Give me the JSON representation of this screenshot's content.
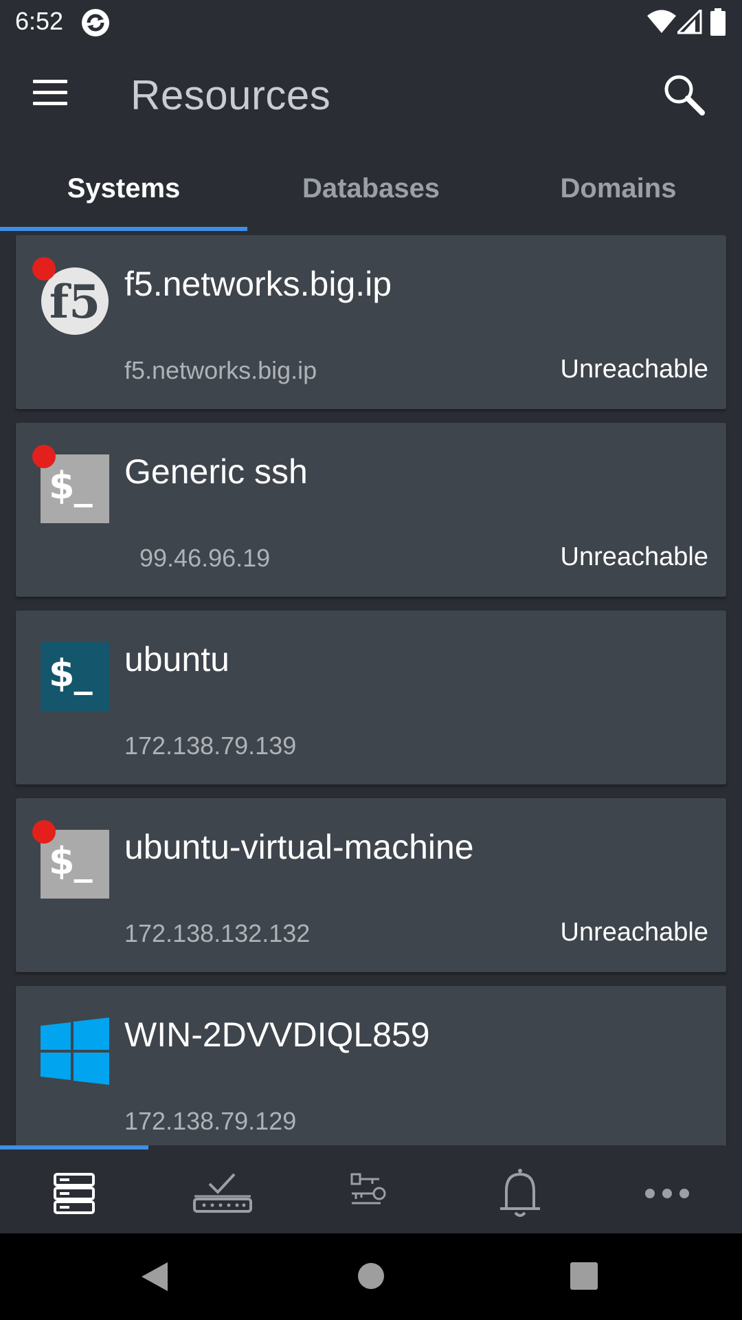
{
  "status_bar": {
    "time": "6:52",
    "app_icon": "sync-badge-icon",
    "icons": [
      "wifi-icon",
      "signal-icon",
      "battery-icon"
    ]
  },
  "app_bar": {
    "title": "Resources",
    "menu_icon": "menu-icon",
    "search_icon": "search-icon"
  },
  "tabs": [
    {
      "label": "Systems",
      "active": true
    },
    {
      "label": "Databases",
      "active": false
    },
    {
      "label": "Domains",
      "active": false
    }
  ],
  "systems": [
    {
      "name": "f5.networks.big.ip",
      "address": "f5.networks.big.ip",
      "status": "Unreachable",
      "icon": "f5-logo-icon",
      "alert": true
    },
    {
      "name": "Generic ssh",
      "address": "99.46.96.19",
      "status": "Unreachable",
      "icon": "ssh-terminal-icon",
      "alert": true
    },
    {
      "name": "ubuntu",
      "address": "172.138.79.139",
      "status": "",
      "icon": "ssh-terminal-icon",
      "alert": false
    },
    {
      "name": "ubuntu-virtual-machine",
      "address": "172.138.132.132",
      "status": "Unreachable",
      "icon": "ssh-terminal-icon",
      "alert": true
    },
    {
      "name": "WIN-2DVVDIQL859",
      "address": "172.138.79.129",
      "status": "",
      "icon": "windows-logo-icon",
      "alert": false
    }
  ],
  "ssh_prompt": "$_",
  "f5_logo_text": "f5",
  "bottom_nav": [
    "servers-icon",
    "approval-checkmark-icon",
    "keys-icon",
    "bell-icon",
    "more-dots-icon"
  ],
  "system_nav": [
    "back-icon",
    "home-icon",
    "recents-icon"
  ],
  "colors": {
    "accent": "#3d8fe8",
    "alert": "#e3201b",
    "background": "#2a2e34",
    "card": "#3f454c",
    "windows": "#00a4ef",
    "ubuntu_tile": "#14566c"
  }
}
